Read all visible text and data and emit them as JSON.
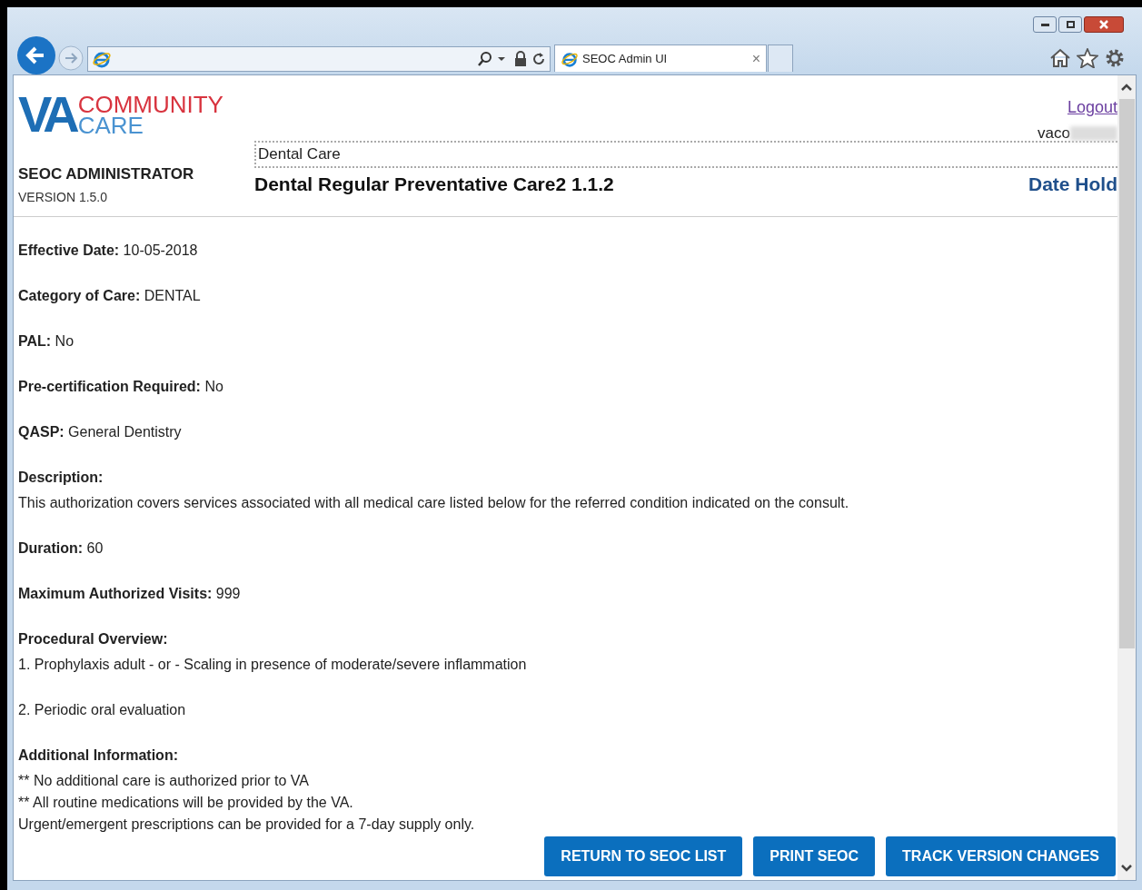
{
  "browser": {
    "tab_title": "SEOC Admin UI",
    "tab_close": "×"
  },
  "header": {
    "logo_main": "VA",
    "logo_line1": "COMMUNITY",
    "logo_line2": "CARE",
    "app_title": "SEOC ADMINISTRATOR",
    "version": "VERSION 1.5.0",
    "logout": "Logout",
    "user": "vaco",
    "category": "Dental Care",
    "seoc_title": "Dental Regular Preventative Care2 1.1.2",
    "status": "Date Hold"
  },
  "fields": [
    {
      "kind": "inline",
      "label": "Effective Date:",
      "value": "10-05-2018"
    },
    {
      "kind": "inline",
      "label": "Category of Care:",
      "value": "DENTAL"
    },
    {
      "kind": "inline",
      "label": "PAL:",
      "value": "No"
    },
    {
      "kind": "inline",
      "label": "Pre-certification Required:",
      "value": "No"
    },
    {
      "kind": "inline",
      "label": "QASP:",
      "value": "General Dentistry"
    },
    {
      "kind": "block",
      "label": "Description:",
      "lines": [
        "This authorization covers services associated with all medical care listed below for the referred condition indicated on the consult."
      ]
    },
    {
      "kind": "inline",
      "label": "Duration:",
      "value": "60"
    },
    {
      "kind": "inline",
      "label": "Maximum Authorized Visits:",
      "value": "999"
    },
    {
      "kind": "list",
      "label": "Procedural Overview:",
      "lines": [
        "1. Prophylaxis adult - or - Scaling in presence of moderate/severe inflammation",
        "2. Periodic oral evaluation"
      ]
    },
    {
      "kind": "block",
      "label": "Additional Information:",
      "lines": [
        "** No additional care is authorized prior to VA",
        "** All routine medications will be provided by the VA.",
        "Urgent/emergent prescriptions can be provided for a 7-day supply only."
      ]
    }
  ],
  "buttons": [
    "RETURN TO SEOC LIST",
    "PRINT SEOC",
    "TRACK VERSION CHANGES"
  ]
}
